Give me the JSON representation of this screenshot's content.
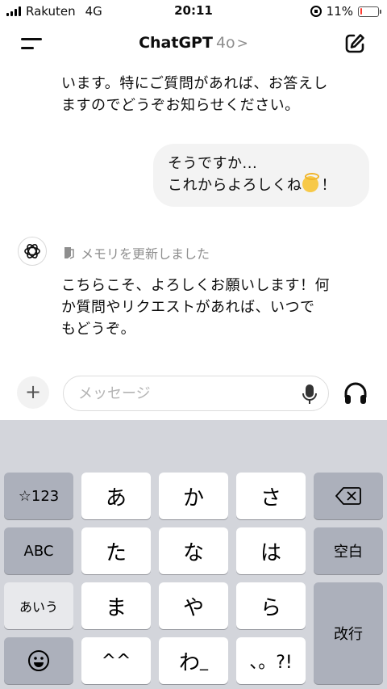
{
  "status_bar": {
    "carrier": "Rakuten",
    "network": "4G",
    "time": "20:11",
    "battery": "11%",
    "battery_level": 0.11,
    "battery_color": "#ff3b30"
  },
  "header": {
    "title": "ChatGPT",
    "model": "4o",
    "chevron": ">",
    "menu_icon": "menu-icon",
    "compose_icon": "compose-icon"
  },
  "messages": {
    "assistant_prev_line1": "います。特にご質問があれば、お答えし",
    "assistant_prev_line2": "ますのでどうぞお知らせください。",
    "user_line1": "そうですか...",
    "user_line2": "これからよろしくね",
    "user_suffix": "！",
    "memory_label": "メモリを更新しました",
    "reply_line1": "こちらこそ、よろしくお願いします！何",
    "reply_line2": "か質問やリクエストがあれば、いつで",
    "reply_line3": "もどうぞ。"
  },
  "composer": {
    "plus_label": "+",
    "placeholder": "メッセージ",
    "mic_icon": "mic-icon",
    "voice_icon": "headphones-icon"
  },
  "keyboard": {
    "row1": [
      "☆123",
      "あ",
      "か",
      "さ"
    ],
    "row2": [
      "ABC",
      "た",
      "な",
      "は",
      "空白"
    ],
    "row3": [
      "あいう",
      "ま",
      "や",
      "ら",
      "改行"
    ],
    "row4": [
      "^^",
      "わ",
      "、。?!"
    ],
    "row4_wa_suffix": "_",
    "row4_face_prefix": "^",
    "row4_face_mid": "_",
    "delete_icon": "backspace-icon",
    "emoji_icon": "emoji-icon"
  }
}
